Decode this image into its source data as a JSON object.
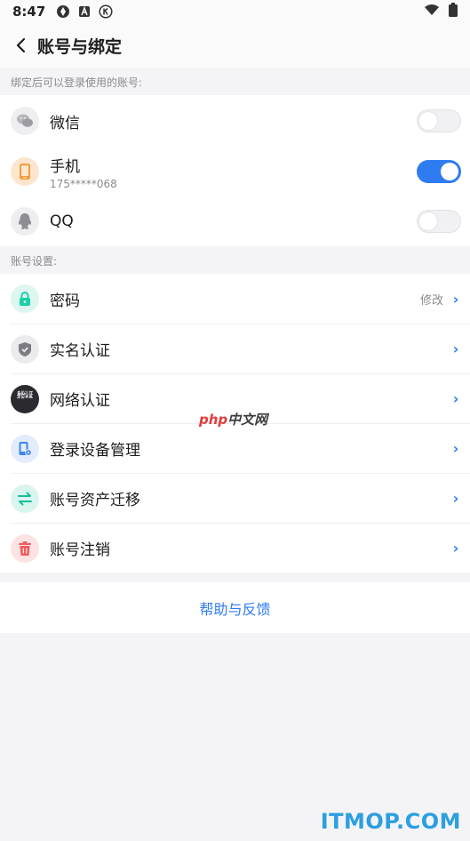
{
  "status_bar": {
    "time": "8:47",
    "icons": [
      "sync-icon",
      "a-badge-icon",
      "k-circle-icon"
    ],
    "right_icons": [
      "wifi-icon",
      "battery-icon"
    ]
  },
  "header": {
    "title": "账号与绑定",
    "back_icon": "chevron-left-icon"
  },
  "bind_section": {
    "label": "绑定后可以登录使用的账号:",
    "items": [
      {
        "label": "微信",
        "sublabel": "",
        "icon": "wechat-icon",
        "enabled": false
      },
      {
        "label": "手机",
        "sublabel": "175*****068",
        "icon": "phone-icon",
        "enabled": true
      },
      {
        "label": "QQ",
        "sublabel": "",
        "icon": "qq-icon",
        "enabled": false
      }
    ]
  },
  "settings_section": {
    "label": "账号设置:",
    "items": [
      {
        "label": "密码",
        "action": "修改",
        "icon": "lock-icon"
      },
      {
        "label": "实名认证",
        "action": "",
        "icon": "shield-icon"
      },
      {
        "label": "网络认证",
        "action": "",
        "icon": "id-badge-icon",
        "badge_text": "身份认证"
      },
      {
        "label": "登录设备管理",
        "action": "",
        "icon": "device-icon"
      },
      {
        "label": "账号资产迁移",
        "action": "",
        "icon": "transfer-icon"
      },
      {
        "label": "账号注销",
        "action": "",
        "icon": "trash-icon"
      }
    ]
  },
  "help": {
    "label": "帮助与反馈"
  },
  "watermarks": {
    "mid_php": "php",
    "mid_cn": "中文网",
    "bottom": "ITMOP.COM"
  },
  "colors": {
    "accent": "#2f7bf1",
    "background": "#f4f4f6",
    "muted_text": "#8a8a8f"
  }
}
